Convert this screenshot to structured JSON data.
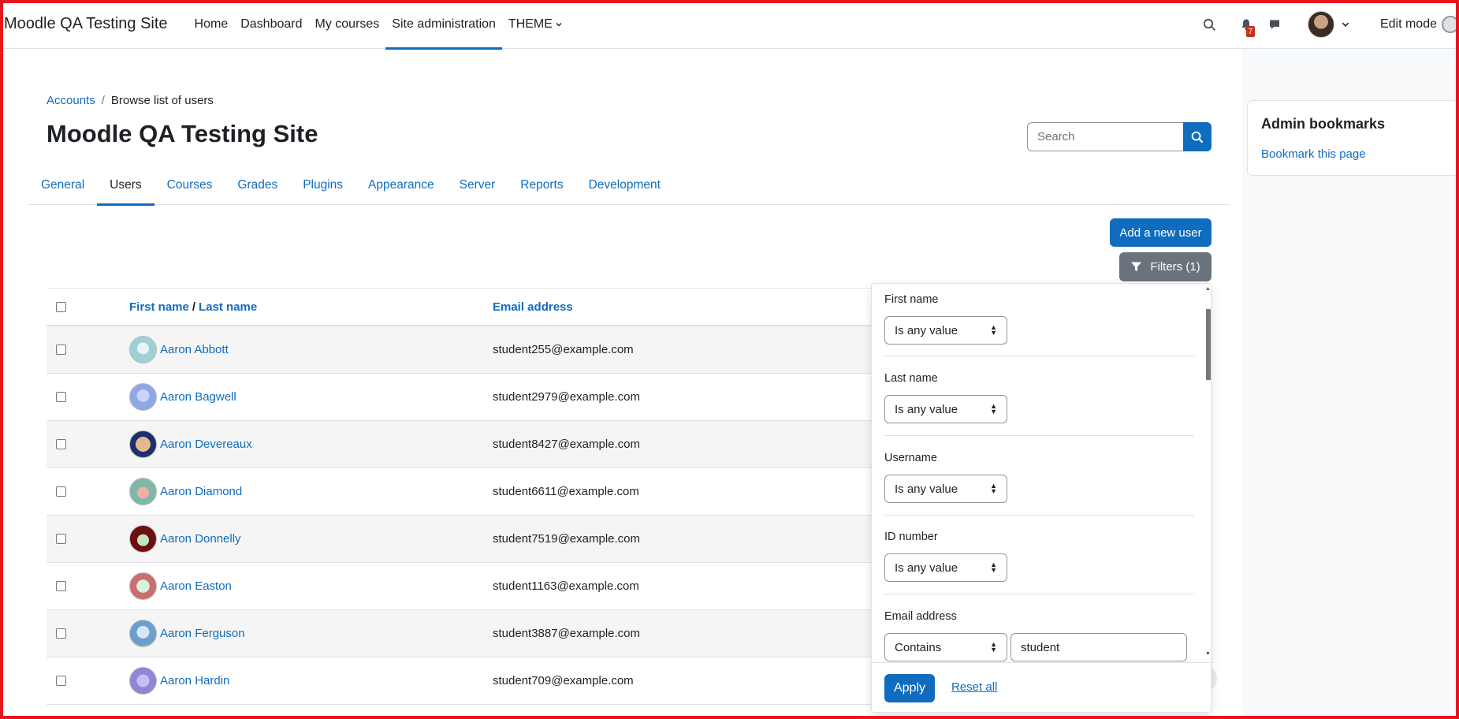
{
  "navbar": {
    "brand": "Moodle QA Testing Site",
    "items": [
      {
        "label": "Home",
        "active": false
      },
      {
        "label": "Dashboard",
        "active": false
      },
      {
        "label": "My courses",
        "active": false
      },
      {
        "label": "Site administration",
        "active": true
      },
      {
        "label": "THEME",
        "active": false
      }
    ],
    "notification_count": "7",
    "edit_mode_label": "Edit mode"
  },
  "breadcrumb": {
    "parent": "Accounts",
    "separator": "/",
    "current": "Browse list of users"
  },
  "page_title": "Moodle QA Testing Site",
  "search": {
    "placeholder": "Search",
    "value": ""
  },
  "tabs": [
    {
      "label": "General",
      "active": false
    },
    {
      "label": "Users",
      "active": true
    },
    {
      "label": "Courses",
      "active": false
    },
    {
      "label": "Grades",
      "active": false
    },
    {
      "label": "Plugins",
      "active": false
    },
    {
      "label": "Appearance",
      "active": false
    },
    {
      "label": "Server",
      "active": false
    },
    {
      "label": "Reports",
      "active": false
    },
    {
      "label": "Development",
      "active": false
    }
  ],
  "actions": {
    "add_user": "Add a new user",
    "filters": "Filters (1)"
  },
  "table": {
    "header": {
      "first_name": "First name",
      "separator": "/",
      "last_name": "Last name",
      "email": "Email address"
    },
    "rows": [
      {
        "name": "Aaron Abbott",
        "email": "student255@example.com",
        "avatar_color": "#9fd0d8"
      },
      {
        "name": "Aaron Bagwell",
        "email": "student2979@example.com",
        "avatar_color": "#8fa6e8"
      },
      {
        "name": "Aaron Devereaux",
        "email": "student8427@example.com",
        "avatar_color": "#1c2f6e"
      },
      {
        "name": "Aaron Diamond",
        "email": "student6611@example.com",
        "avatar_color": "#7fb8a8"
      },
      {
        "name": "Aaron Donnelly",
        "email": "student7519@example.com",
        "avatar_color": "#6b1010"
      },
      {
        "name": "Aaron Easton",
        "email": "student1163@example.com",
        "avatar_color": "#c96f6f"
      },
      {
        "name": "Aaron Ferguson",
        "email": "student3887@example.com",
        "avatar_color": "#6c9fd0"
      },
      {
        "name": "Aaron Hardin",
        "email": "student709@example.com",
        "avatar_color": "#8e86d6"
      }
    ]
  },
  "filters": {
    "groups": [
      {
        "label": "First name",
        "operator": "Is any value",
        "value": ""
      },
      {
        "label": "Last name",
        "operator": "Is any value",
        "value": ""
      },
      {
        "label": "Username",
        "operator": "Is any value",
        "value": ""
      },
      {
        "label": "ID number",
        "operator": "Is any value",
        "value": ""
      },
      {
        "label": "Email address",
        "operator": "Contains",
        "value": "student"
      }
    ],
    "apply": "Apply",
    "reset": "Reset all"
  },
  "bookmarks": {
    "title": "Admin bookmarks",
    "link": "Bookmark this page"
  },
  "colors": {
    "accent": "#0f6cbf",
    "secondary_button": "#6a737b",
    "frame": "#e8161c"
  }
}
